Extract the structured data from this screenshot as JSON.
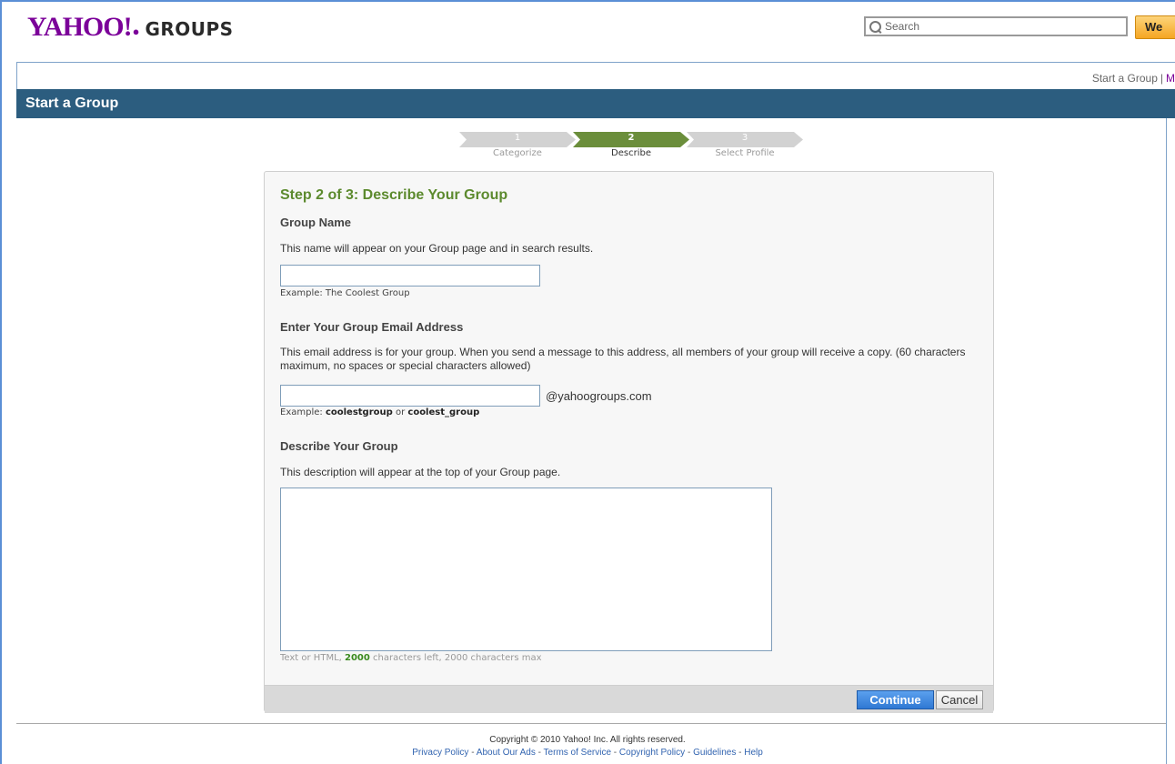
{
  "header": {
    "logo_main": "YAHOO!",
    "logo_groups": "GROUPS",
    "search_placeholder": "Search",
    "search_button_label": "We"
  },
  "nav": {
    "start_group_link": "Start a Group",
    "separator": "|",
    "cut_link": "M"
  },
  "title_bar": "Start a Group",
  "progress": {
    "steps": [
      {
        "num": "1",
        "label": "Categorize",
        "state": "done"
      },
      {
        "num": "2",
        "label": "Describe",
        "state": "active"
      },
      {
        "num": "3",
        "label": "Select Profile",
        "state": "todo"
      }
    ]
  },
  "form": {
    "title": "Step 2 of 3: Describe Your Group",
    "group_name": {
      "heading": "Group Name",
      "description": "This name will appear on your Group page and in search results.",
      "value": "",
      "example": "Example: The Coolest Group"
    },
    "email": {
      "heading": "Enter Your Group Email Address",
      "description": "This email address is for your group. When you send a message to this address, all members of your group will receive a copy. (60 characters maximum, no spaces or special characters allowed)",
      "value": "",
      "suffix": "@yahoogroups.com",
      "example_prefix": "Example: ",
      "example_a": "coolestgroup",
      "example_or": " or ",
      "example_b": "coolest_group"
    },
    "describe": {
      "heading": "Describe Your Group",
      "description": "This description will appear at the top of your Group page.",
      "value": "",
      "counter_prefix": "Text or HTML, ",
      "counter_left": "2000",
      "counter_suffix": " characters left, 2000 characters max"
    },
    "continue_label": "Continue",
    "cancel_label": "Cancel"
  },
  "footer": {
    "copyright": "Copyright © 2010 Yahoo! Inc. All rights reserved.",
    "links": [
      "Privacy Policy",
      "About Our Ads",
      "Terms of Service",
      "Copyright Policy",
      "Guidelines",
      "Help"
    ],
    "link_sep": " - "
  },
  "colors": {
    "brand_purple": "#7b0099",
    "title_bar_bg": "#2c5d7f",
    "step_active": "#6b8e3b",
    "step_inactive": "#d2d2d2",
    "accent_green": "#5c8a2e",
    "button_blue": "#2f78d3"
  }
}
